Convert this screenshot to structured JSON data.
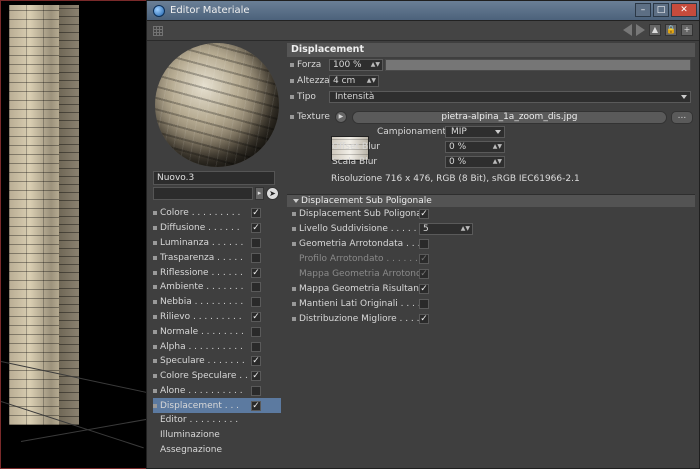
{
  "window": {
    "title": "Editor Materiale"
  },
  "material": {
    "name": "Nuovo.3"
  },
  "channels": [
    {
      "label": "Colore . . . . . . . . .",
      "checked": true
    },
    {
      "label": "Diffusione . . . . . .",
      "checked": true
    },
    {
      "label": "Luminanza . . . . . .",
      "checked": false
    },
    {
      "label": "Trasparenza . . . . .",
      "checked": false
    },
    {
      "label": "Riflessione . . . . . .",
      "checked": true
    },
    {
      "label": "Ambiente . . . . . . .",
      "checked": false
    },
    {
      "label": "Nebbia . . . . . . . . .",
      "checked": false
    },
    {
      "label": "Rilievo . . . . . . . . .",
      "checked": true
    },
    {
      "label": "Normale . . . . . . . .",
      "checked": false
    },
    {
      "label": "Alpha . . . . . . . . . .",
      "checked": false
    },
    {
      "label": "Speculare . . . . . . .",
      "checked": true
    },
    {
      "label": "Colore Speculare . .",
      "checked": true
    },
    {
      "label": "Alone . . . . . . . . . .",
      "checked": false
    },
    {
      "label": "Displacement . . .",
      "checked": true,
      "selected": true
    }
  ],
  "extra_items": [
    "Editor . . . . . . . . .",
    "Illuminazione",
    "Assegnazione"
  ],
  "displacement": {
    "header": "Displacement",
    "forza_label": "Forza",
    "forza_value": "100 %",
    "altezza_label": "Altezza",
    "altezza_value": "4 cm",
    "tipo_label": "Tipo",
    "tipo_value": "Intensità",
    "texture_label": "Texture",
    "texture_file": "pietra-alpina_1a_zoom_dis.jpg",
    "more_label": "...",
    "campionamento_label": "Campionamento",
    "campionamento_value": "MIP",
    "offset_blur_label": "Offset Blur",
    "offset_blur_value": "0 %",
    "scala_blur_label": "Scala Blur",
    "scala_blur_value": "0 %",
    "resolution_info": "Risoluzione 716 x 476, RGB (8 Bit), sRGB IEC61966-2.1"
  },
  "sub_poly": {
    "header": "Displacement Sub Poligonale",
    "livello_value": "5",
    "rows": [
      {
        "label": "Displacement Sub Poligonale",
        "checked": true,
        "disabled": false
      },
      {
        "label": "Livello Suddivisione . . . . . . . .",
        "checked": null,
        "disabled": false
      },
      {
        "label": "Geometria Arrotondata . . . . . . . .",
        "checked": false,
        "disabled": false
      },
      {
        "label": "Profilo Arrotondato . . . . . . . .",
        "checked": true,
        "disabled": true
      },
      {
        "label": "Mappa Geometria Arrotondata",
        "checked": true,
        "disabled": true
      },
      {
        "label": "Mappa Geometria Risultante",
        "checked": true,
        "disabled": false
      },
      {
        "label": "Mantieni Lati Originali . . . . . . .",
        "checked": false,
        "disabled": false
      },
      {
        "label": "Distribuzione Migliore . . . . . . .",
        "checked": true,
        "disabled": false
      }
    ]
  },
  "colors": {
    "titlebar": "#4c627b",
    "panel": "#3f3f3f",
    "selection": "#5c7aa0"
  }
}
